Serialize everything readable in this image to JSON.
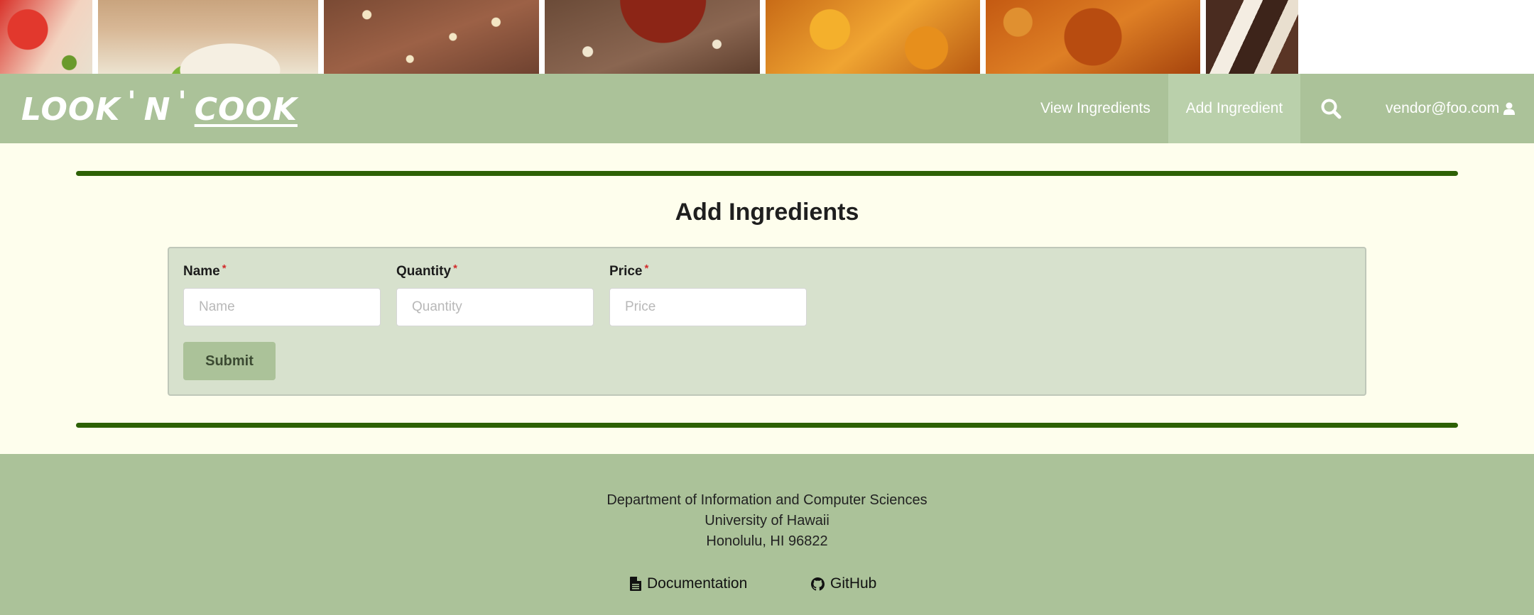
{
  "banner": {
    "photos": [
      "strawberry-dish",
      "noodle-dish",
      "granola-bar",
      "hazelnut-brownie",
      "peach-dessert",
      "glazed-dish",
      "chocolate-cake"
    ]
  },
  "navbar": {
    "brand_look": "LOOK",
    "brand_apos1": "'",
    "brand_n": "N",
    "brand_apos2": "'",
    "brand_cook": "COOK",
    "items": [
      {
        "label": "View Ingredients"
      },
      {
        "label": "Add Ingredient",
        "active": true
      }
    ],
    "search_icon": "search-icon",
    "user_email": "vendor@foo.com",
    "user_icon": "user-icon"
  },
  "main": {
    "title": "Add Ingredients",
    "fields": [
      {
        "label": "Name",
        "required_mark": "*",
        "placeholder": "Name",
        "value": ""
      },
      {
        "label": "Quantity",
        "required_mark": "*",
        "placeholder": "Quantity",
        "value": ""
      },
      {
        "label": "Price",
        "required_mark": "*",
        "placeholder": "Price",
        "value": ""
      }
    ],
    "submit_label": "Submit"
  },
  "footer": {
    "lines": [
      "Department of Information and Computer Sciences",
      "University of Hawaii",
      "Honolulu, HI 96822"
    ],
    "links": [
      {
        "label": "Documentation",
        "icon": "file-icon"
      },
      {
        "label": "GitHub",
        "icon": "github-icon"
      }
    ]
  },
  "colors": {
    "navbar": "#abc299",
    "active_nav": "#bad0ab",
    "page_bg": "#fefeed",
    "rule": "#2d6105",
    "form_panel": "#d7e1cd",
    "required": "#d22b2b"
  }
}
